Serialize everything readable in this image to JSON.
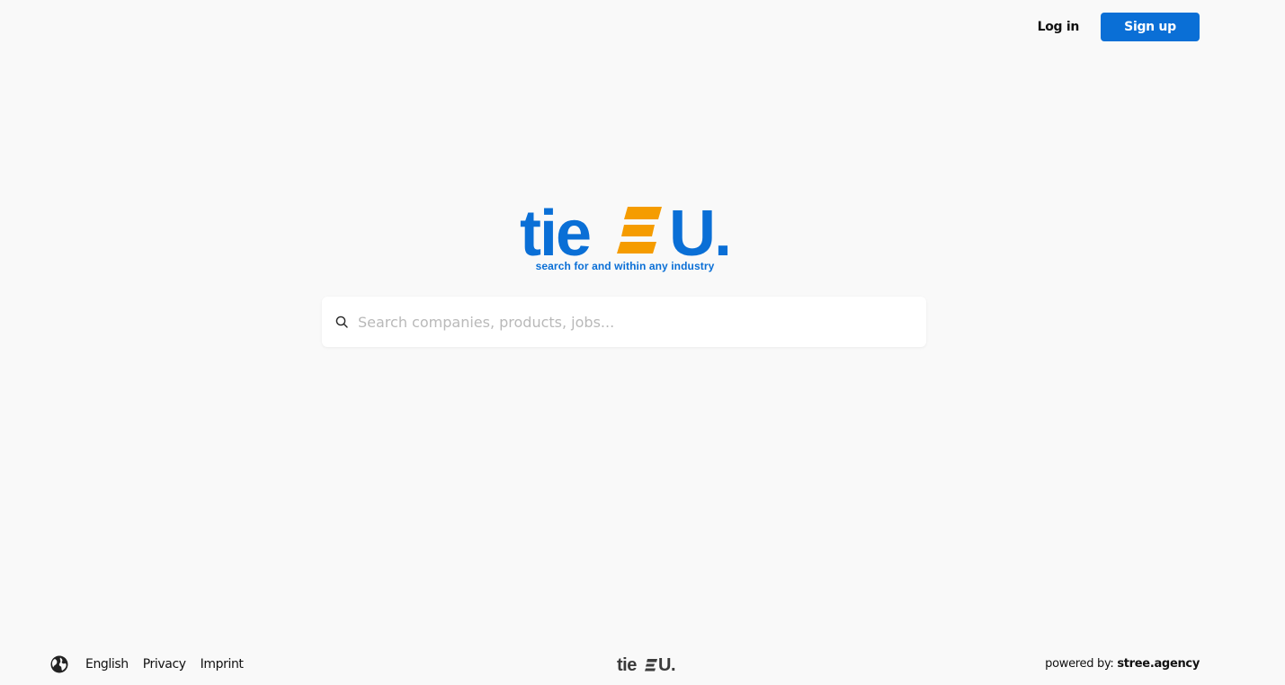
{
  "header": {
    "login_label": "Log in",
    "signup_label": "Sign up"
  },
  "logo": {
    "text_left": "tie",
    "text_right": "U.",
    "tagline": "search for and within any industry",
    "primary_color": "#0a6fd6",
    "accent_color": "#f59c00"
  },
  "search": {
    "placeholder": "Search companies, products, jobs..."
  },
  "footer": {
    "globe_icon": "globe-icon",
    "language": "English",
    "privacy": "Privacy",
    "imprint": "Imprint",
    "logo_left": "tie",
    "logo_right": "U.",
    "powered_by_label": "powered by:",
    "powered_by_name": "stree.agency",
    "logo_color": "#3b3b3b"
  }
}
